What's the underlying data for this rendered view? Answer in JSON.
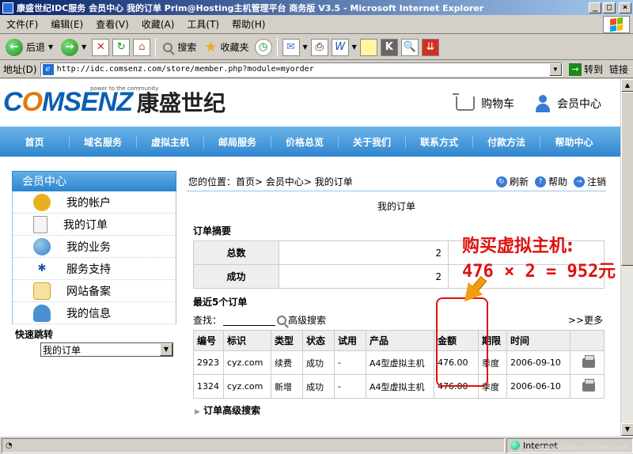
{
  "window": {
    "title": "康盛世纪IDC服务 会员中心 我的订单 Prim@Hosting主机管理平台 商务版 V3.5 - Microsoft Internet Explorer",
    "buttons": {
      "min": "_",
      "max": "□",
      "close": "×"
    }
  },
  "menubar": [
    "文件(F)",
    "编辑(E)",
    "查看(V)",
    "收藏(A)",
    "工具(T)",
    "帮助(H)"
  ],
  "toolbar": {
    "back": "后退",
    "search": "搜索",
    "favorites": "收藏夹"
  },
  "address": {
    "label": "地址(D)",
    "url": "http://idc.comsenz.com/store/member.php?module=myorder",
    "go": "转到",
    "links": "链接"
  },
  "header": {
    "tagline": "power to the community",
    "brand": "COMSENZ",
    "brand_cn": "康盛世纪",
    "cart": "购物车",
    "member": "会员中心"
  },
  "nav": [
    "首页",
    "域名服务",
    "虚拟主机",
    "邮局服务",
    "价格总览",
    "关于我们",
    "联系方式",
    "付款方法",
    "帮助中心"
  ],
  "sidebar": {
    "title": "会员中心",
    "items": [
      {
        "label": "我的帐户",
        "icon": "coins-icon",
        "color": "#e8b020"
      },
      {
        "label": "我的订单",
        "icon": "document-icon",
        "color": "#f4f4f4"
      },
      {
        "label": "我的业务",
        "icon": "globe-icon",
        "color": "#3a7bd5"
      },
      {
        "label": "服务支持",
        "icon": "support-icon",
        "color": "#2050a0"
      },
      {
        "label": "网站备案",
        "icon": "certificate-icon",
        "color": "#d4a020"
      },
      {
        "label": "我的信息",
        "icon": "user-info-icon",
        "color": "#4a90d0"
      }
    ],
    "quick_label": "快速跳转",
    "quick_value": "我的订单"
  },
  "main": {
    "breadcrumb": "您的位置：首页> 会员中心> 我的订单",
    "actions": {
      "refresh": "刷新",
      "help": "帮助",
      "logout": "注销"
    },
    "page_title": "我的订单",
    "summary_title": "订单摘要",
    "summary": [
      {
        "label": "总数",
        "value": "2"
      },
      {
        "label": "成功",
        "value": "2"
      }
    ],
    "recent_title": "最近5个订单",
    "search_label": "查找：",
    "advanced_search": "高级搜索",
    "more": ">>更多",
    "columns": [
      "编号",
      "标识",
      "类型",
      "状态",
      "试用",
      "产品",
      "金额",
      "期限",
      "时间",
      ""
    ],
    "rows": [
      [
        "2923",
        "cyz.com",
        "续费",
        "成功",
        "-",
        "A4型虚拟主机",
        "476.00",
        "季度",
        "2006-09-10"
      ],
      [
        "1324",
        "cyz.com",
        "新增",
        "成功",
        "-",
        "A4型虚拟主机",
        "476.00",
        "季度",
        "2006-06-10"
      ]
    ],
    "order_adv_search": "订单高级搜索"
  },
  "annotation": {
    "line1": "购买虚拟主机:",
    "line2": "476 × 2 = 952元"
  },
  "status": {
    "zone": "Internet",
    "watermark": "www.AokkaOnline.com"
  }
}
